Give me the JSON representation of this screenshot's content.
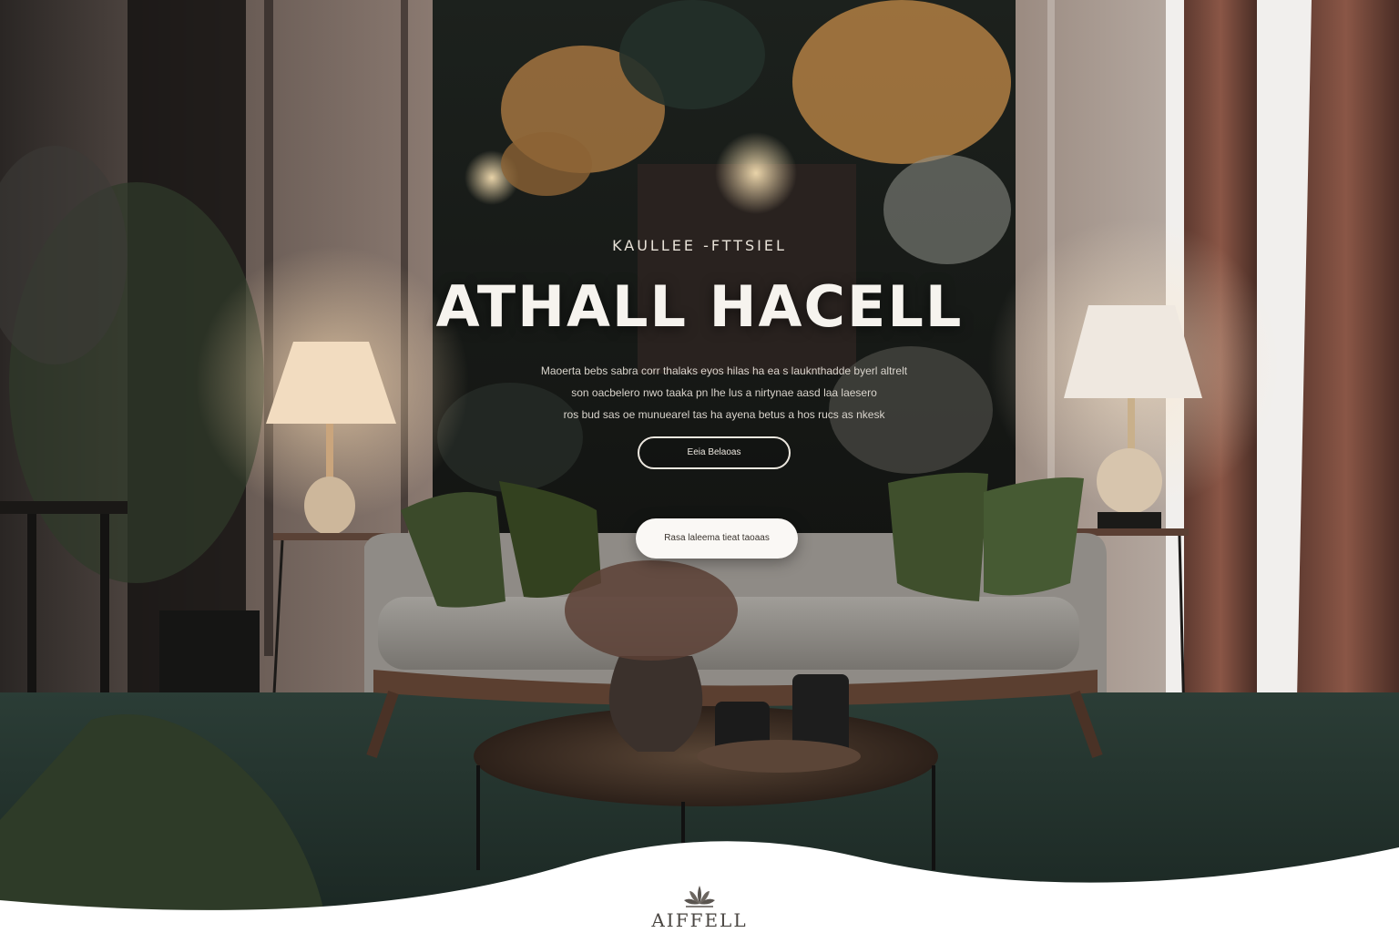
{
  "hero": {
    "eyebrow": "KAULLEE -FTTSIEL",
    "title": "ATHALL HACELL",
    "description_lines": [
      "Maoerta bebs sabra corr thalaks eyos hilas ha ea s lauknthadde byerl altrelt",
      "son oacbelero nwo taaka pn lhe lus a nirtynae aasd laa  laesero",
      "ros bud sas oe munuearel tas ha ayena betus a hos rucs as nkesk"
    ],
    "secondary_button": "Eeia Belaoas",
    "primary_button": "Rasa laleema tieat taoaas"
  },
  "footer": {
    "brand_name": "AIFFELL",
    "brand_icon": "lotus-icon",
    "background": "#ffffff"
  },
  "colors": {
    "title": "#f6f3ee",
    "button_outline": "#ece7df",
    "button_solid_bg": "#faf8f5",
    "pillow_green": "#3f4f2c",
    "carpet": "#263a32",
    "curtain": "#7a4a3c"
  }
}
